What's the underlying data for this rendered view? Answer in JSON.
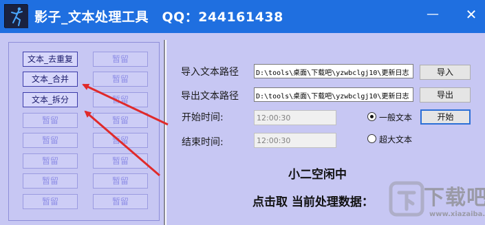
{
  "window": {
    "title": "影子_文本处理工具　QQ：244161438",
    "minimize_glyph": "—",
    "close_glyph": "✕"
  },
  "left_panel": {
    "buttons": [
      {
        "label": "文本_去重复",
        "state": "active"
      },
      {
        "label": "暂留",
        "state": "idle"
      },
      {
        "label": "文本_合并",
        "state": "active"
      },
      {
        "label": "暂留",
        "state": "idle"
      },
      {
        "label": "文本_拆分",
        "state": "active"
      },
      {
        "label": "暂留",
        "state": "idle"
      },
      {
        "label": "暂留",
        "state": "idle"
      },
      {
        "label": "暂留",
        "state": "idle"
      },
      {
        "label": "暂留",
        "state": "idle"
      },
      {
        "label": "暂留",
        "state": "idle"
      },
      {
        "label": "暂留",
        "state": "idle"
      },
      {
        "label": "暂留",
        "state": "idle"
      },
      {
        "label": "暂留",
        "state": "idle"
      },
      {
        "label": "暂留",
        "state": "idle"
      },
      {
        "label": "暂留",
        "state": "idle"
      },
      {
        "label": "暂留",
        "state": "idle"
      }
    ]
  },
  "form": {
    "import_label": "导入文本路径",
    "import_path": "D:\\tools\\桌面\\下载吧\\yzwbclgj10\\更新日志",
    "import_button": "导入",
    "export_label": "导出文本路径",
    "export_path": "D:\\tools\\桌面\\下载吧\\yzwbclgj10\\更新日志",
    "export_button": "导出",
    "start_time_label": "开始时间:",
    "start_time_value": "12:00:30",
    "end_time_label": "结束时间:",
    "end_time_value": "12:00:30",
    "radio_normal": "一般文本",
    "radio_large": "超大文本",
    "radio_selected": "normal",
    "start_button": "开始"
  },
  "status": {
    "line1": "小二空闲中",
    "line2": "点击取 当前处理数据："
  },
  "watermark": {
    "main": "下载吧",
    "sub": "www.xiazaiba.com"
  },
  "colors": {
    "titlebar": "#1f6fe0",
    "client_bg": "#c7c7f3",
    "arrow": "#e02a2a",
    "active_button_border": "#3a3aa8",
    "idle_button_text": "#8e8ee6"
  },
  "annotations": {
    "arrow_count": 2,
    "arrow_targets": [
      "文本_合并",
      "文本_拆分"
    ]
  }
}
